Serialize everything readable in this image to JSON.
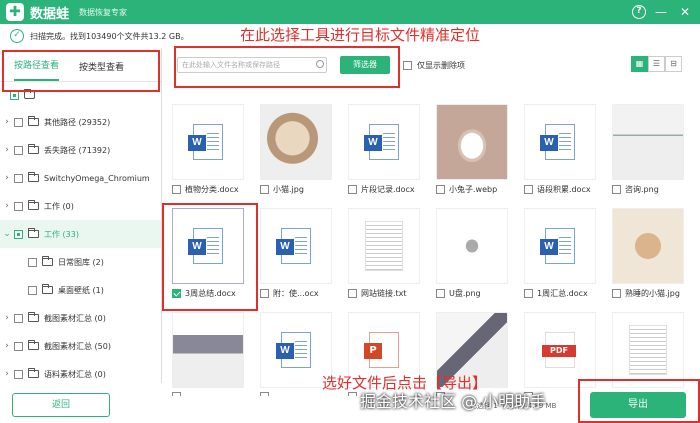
{
  "titlebar": {
    "app_name": "数据蛙",
    "subtitle": "数据恢复专家",
    "help": "?",
    "minimize": "—",
    "close": "✕"
  },
  "status": {
    "text": "扫描完成。找到103490个文件共13.2 GB。"
  },
  "annotations": {
    "top": "在此选择工具进行目标文件精准定位",
    "bottom": "选好文件后点击【导出】"
  },
  "sidebar": {
    "tabs": [
      {
        "label": "按路径查看",
        "active": true
      },
      {
        "label": "按类型查看",
        "active": false
      }
    ],
    "tree": [
      {
        "label": "其他路径 (29352)"
      },
      {
        "label": "丢失路径 (71392)"
      },
      {
        "label": "SwitchyOmega_Chromium"
      },
      {
        "label": "工作 (0)"
      },
      {
        "label": "工作 (33)"
      },
      {
        "label": "日常图库 (2)"
      },
      {
        "label": "桌面壁纸 (1)"
      },
      {
        "label": "截图素材汇总 (0)"
      },
      {
        "label": "截图素材汇总 (50)"
      },
      {
        "label": "语料素材汇总 (0)"
      }
    ],
    "back_label": "返回"
  },
  "toolbar": {
    "search_placeholder": "在此处输入文件名称或保存路径",
    "filter_label": "筛选器",
    "only_deleted_label": "仅显示删除项",
    "views": [
      "▦",
      "☰",
      "⊟"
    ]
  },
  "files": [
    {
      "name": "植物分类.docx",
      "kind": "word"
    },
    {
      "name": "小猫.jpg",
      "kind": "photo-cat"
    },
    {
      "name": "片段记录.docx",
      "kind": "word"
    },
    {
      "name": "小兔子.webp",
      "kind": "photo-rabbit"
    },
    {
      "name": "语段积累.docx",
      "kind": "word"
    },
    {
      "name": "咨询.png",
      "kind": "photo-office"
    },
    {
      "name": "3周总结.docx",
      "kind": "word"
    },
    {
      "name": "附：使...ocx",
      "kind": "word"
    },
    {
      "name": "网站链接.txt",
      "kind": "txt"
    },
    {
      "name": "U盘.png",
      "kind": "photo-usb"
    },
    {
      "name": "1周汇总.docx",
      "kind": "word"
    },
    {
      "name": "熟睡的小猫.jpg",
      "kind": "photo-kitten"
    },
    {
      "name": "",
      "kind": "photo-laptop"
    },
    {
      "name": "",
      "kind": "word"
    },
    {
      "name": "",
      "kind": "ppt"
    },
    {
      "name": "",
      "kind": "photo-desk"
    },
    {
      "name": "",
      "kind": "pdf"
    },
    {
      "name": "",
      "kind": "txt"
    }
  ],
  "footer": {
    "count_text": "已选择 1 个文件 / 4.89 MB",
    "export_label": "导出"
  },
  "watermark": "掘金技术社区 @ 小明助手",
  "colors": {
    "accent": "#2bb37a",
    "annotation": "#e0302c"
  }
}
